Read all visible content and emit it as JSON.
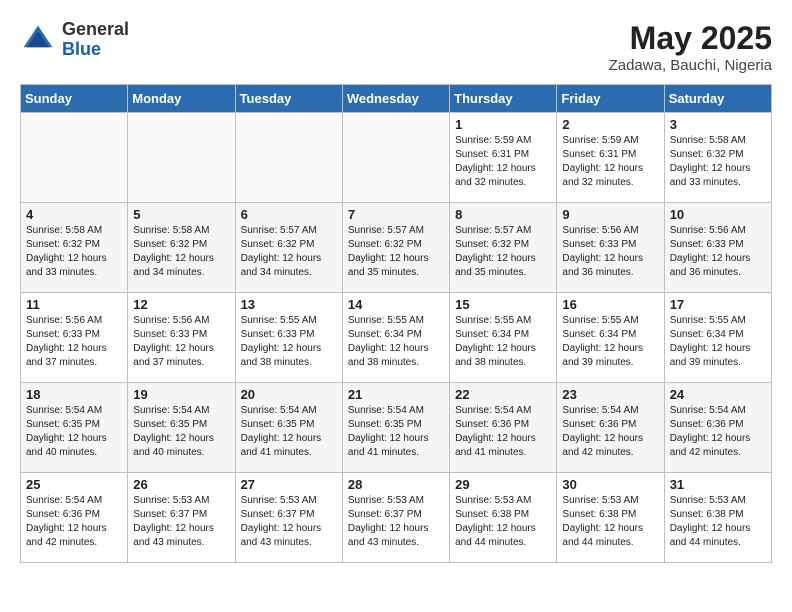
{
  "header": {
    "logo_general": "General",
    "logo_blue": "Blue",
    "month": "May 2025",
    "location": "Zadawa, Bauchi, Nigeria"
  },
  "weekdays": [
    "Sunday",
    "Monday",
    "Tuesday",
    "Wednesday",
    "Thursday",
    "Friday",
    "Saturday"
  ],
  "weeks": [
    [
      {
        "day": "",
        "info": ""
      },
      {
        "day": "",
        "info": ""
      },
      {
        "day": "",
        "info": ""
      },
      {
        "day": "",
        "info": ""
      },
      {
        "day": "1",
        "info": "Sunrise: 5:59 AM\nSunset: 6:31 PM\nDaylight: 12 hours\nand 32 minutes."
      },
      {
        "day": "2",
        "info": "Sunrise: 5:59 AM\nSunset: 6:31 PM\nDaylight: 12 hours\nand 32 minutes."
      },
      {
        "day": "3",
        "info": "Sunrise: 5:58 AM\nSunset: 6:32 PM\nDaylight: 12 hours\nand 33 minutes."
      }
    ],
    [
      {
        "day": "4",
        "info": "Sunrise: 5:58 AM\nSunset: 6:32 PM\nDaylight: 12 hours\nand 33 minutes."
      },
      {
        "day": "5",
        "info": "Sunrise: 5:58 AM\nSunset: 6:32 PM\nDaylight: 12 hours\nand 34 minutes."
      },
      {
        "day": "6",
        "info": "Sunrise: 5:57 AM\nSunset: 6:32 PM\nDaylight: 12 hours\nand 34 minutes."
      },
      {
        "day": "7",
        "info": "Sunrise: 5:57 AM\nSunset: 6:32 PM\nDaylight: 12 hours\nand 35 minutes."
      },
      {
        "day": "8",
        "info": "Sunrise: 5:57 AM\nSunset: 6:32 PM\nDaylight: 12 hours\nand 35 minutes."
      },
      {
        "day": "9",
        "info": "Sunrise: 5:56 AM\nSunset: 6:33 PM\nDaylight: 12 hours\nand 36 minutes."
      },
      {
        "day": "10",
        "info": "Sunrise: 5:56 AM\nSunset: 6:33 PM\nDaylight: 12 hours\nand 36 minutes."
      }
    ],
    [
      {
        "day": "11",
        "info": "Sunrise: 5:56 AM\nSunset: 6:33 PM\nDaylight: 12 hours\nand 37 minutes."
      },
      {
        "day": "12",
        "info": "Sunrise: 5:56 AM\nSunset: 6:33 PM\nDaylight: 12 hours\nand 37 minutes."
      },
      {
        "day": "13",
        "info": "Sunrise: 5:55 AM\nSunset: 6:33 PM\nDaylight: 12 hours\nand 38 minutes."
      },
      {
        "day": "14",
        "info": "Sunrise: 5:55 AM\nSunset: 6:34 PM\nDaylight: 12 hours\nand 38 minutes."
      },
      {
        "day": "15",
        "info": "Sunrise: 5:55 AM\nSunset: 6:34 PM\nDaylight: 12 hours\nand 38 minutes."
      },
      {
        "day": "16",
        "info": "Sunrise: 5:55 AM\nSunset: 6:34 PM\nDaylight: 12 hours\nand 39 minutes."
      },
      {
        "day": "17",
        "info": "Sunrise: 5:55 AM\nSunset: 6:34 PM\nDaylight: 12 hours\nand 39 minutes."
      }
    ],
    [
      {
        "day": "18",
        "info": "Sunrise: 5:54 AM\nSunset: 6:35 PM\nDaylight: 12 hours\nand 40 minutes."
      },
      {
        "day": "19",
        "info": "Sunrise: 5:54 AM\nSunset: 6:35 PM\nDaylight: 12 hours\nand 40 minutes."
      },
      {
        "day": "20",
        "info": "Sunrise: 5:54 AM\nSunset: 6:35 PM\nDaylight: 12 hours\nand 41 minutes."
      },
      {
        "day": "21",
        "info": "Sunrise: 5:54 AM\nSunset: 6:35 PM\nDaylight: 12 hours\nand 41 minutes."
      },
      {
        "day": "22",
        "info": "Sunrise: 5:54 AM\nSunset: 6:36 PM\nDaylight: 12 hours\nand 41 minutes."
      },
      {
        "day": "23",
        "info": "Sunrise: 5:54 AM\nSunset: 6:36 PM\nDaylight: 12 hours\nand 42 minutes."
      },
      {
        "day": "24",
        "info": "Sunrise: 5:54 AM\nSunset: 6:36 PM\nDaylight: 12 hours\nand 42 minutes."
      }
    ],
    [
      {
        "day": "25",
        "info": "Sunrise: 5:54 AM\nSunset: 6:36 PM\nDaylight: 12 hours\nand 42 minutes."
      },
      {
        "day": "26",
        "info": "Sunrise: 5:53 AM\nSunset: 6:37 PM\nDaylight: 12 hours\nand 43 minutes."
      },
      {
        "day": "27",
        "info": "Sunrise: 5:53 AM\nSunset: 6:37 PM\nDaylight: 12 hours\nand 43 minutes."
      },
      {
        "day": "28",
        "info": "Sunrise: 5:53 AM\nSunset: 6:37 PM\nDaylight: 12 hours\nand 43 minutes."
      },
      {
        "day": "29",
        "info": "Sunrise: 5:53 AM\nSunset: 6:38 PM\nDaylight: 12 hours\nand 44 minutes."
      },
      {
        "day": "30",
        "info": "Sunrise: 5:53 AM\nSunset: 6:38 PM\nDaylight: 12 hours\nand 44 minutes."
      },
      {
        "day": "31",
        "info": "Sunrise: 5:53 AM\nSunset: 6:38 PM\nDaylight: 12 hours\nand 44 minutes."
      }
    ]
  ]
}
